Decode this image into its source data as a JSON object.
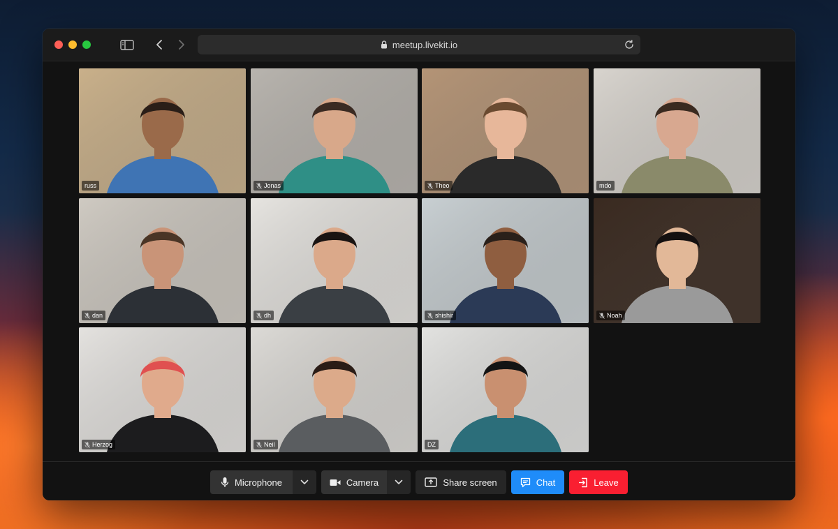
{
  "browser": {
    "url": "meetup.livekit.io"
  },
  "participants": [
    {
      "name": "russ",
      "muted": false,
      "active": true,
      "bg": "#c9b08a",
      "skin": "#9a6a4a",
      "hair": "#2a1e18",
      "shirt": "#3f74b4"
    },
    {
      "name": "Jonas",
      "muted": true,
      "active": false,
      "bg": "#b8b4ae",
      "skin": "#d8a88a",
      "hair": "#3a2a22",
      "shirt": "#2f8f86"
    },
    {
      "name": "Theo",
      "muted": true,
      "active": false,
      "bg": "#b49476",
      "skin": "#e7b79a",
      "hair": "#6a4a30",
      "shirt": "#2a2a2a"
    },
    {
      "name": "mdo",
      "muted": false,
      "active": false,
      "bg": "#d8d4ce",
      "skin": "#d8a890",
      "hair": "#3a2a20",
      "shirt": "#8a8a6a"
    },
    {
      "name": "dan",
      "muted": true,
      "active": false,
      "bg": "#cfcac2",
      "skin": "#c99478",
      "hair": "#4a3526",
      "shirt": "#2c3036"
    },
    {
      "name": "dh",
      "muted": true,
      "active": false,
      "bg": "#e6e4e0",
      "skin": "#dba98a",
      "hair": "#1a1412",
      "shirt": "#3a3f44"
    },
    {
      "name": "shishir",
      "muted": true,
      "active": false,
      "bg": "#c8cfd2",
      "skin": "#8f5e40",
      "hair": "#2a201a",
      "shirt": "#2b3a56"
    },
    {
      "name": "Noah",
      "muted": true,
      "active": false,
      "bg": "#3a2a20",
      "skin": "#e2b898",
      "hair": "#141010",
      "shirt": "#9a9a9a"
    },
    {
      "name": "Herzog",
      "muted": true,
      "active": false,
      "bg": "#e4e2df",
      "skin": "#e0aa8c",
      "hair": "#e05050",
      "shirt": "#1c1c1e"
    },
    {
      "name": "Neil",
      "muted": true,
      "active": false,
      "bg": "#dcdad6",
      "skin": "#dcaa8a",
      "hair": "#2a1c16",
      "shirt": "#5a5d60"
    },
    {
      "name": "DZ",
      "muted": false,
      "active": false,
      "bg": "#e2e2e0",
      "skin": "#c99070",
      "hair": "#141414",
      "shirt": "#2c6e7a"
    }
  ],
  "controls": {
    "microphone_label": "Microphone",
    "camera_label": "Camera",
    "share_label": "Share screen",
    "chat_label": "Chat",
    "leave_label": "Leave"
  },
  "colors": {
    "accent": "#1f8cf9",
    "danger": "#f91f31",
    "active_speaker": "#2e80ff"
  }
}
